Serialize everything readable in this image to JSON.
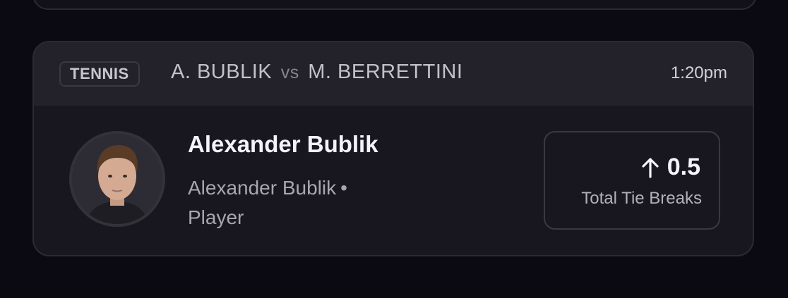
{
  "match": {
    "sport": "TENNIS",
    "player_a": "A. BUBLIK",
    "vs": "vs",
    "player_b": "M. BERRETTINI",
    "time": "1:20pm"
  },
  "player": {
    "name": "Alexander Bublik",
    "team": "Alexander Bublik",
    "separator": "•",
    "position": "Player"
  },
  "prop": {
    "direction_icon": "arrow-up-icon",
    "line": "0.5",
    "stat": "Total Tie Breaks"
  }
}
